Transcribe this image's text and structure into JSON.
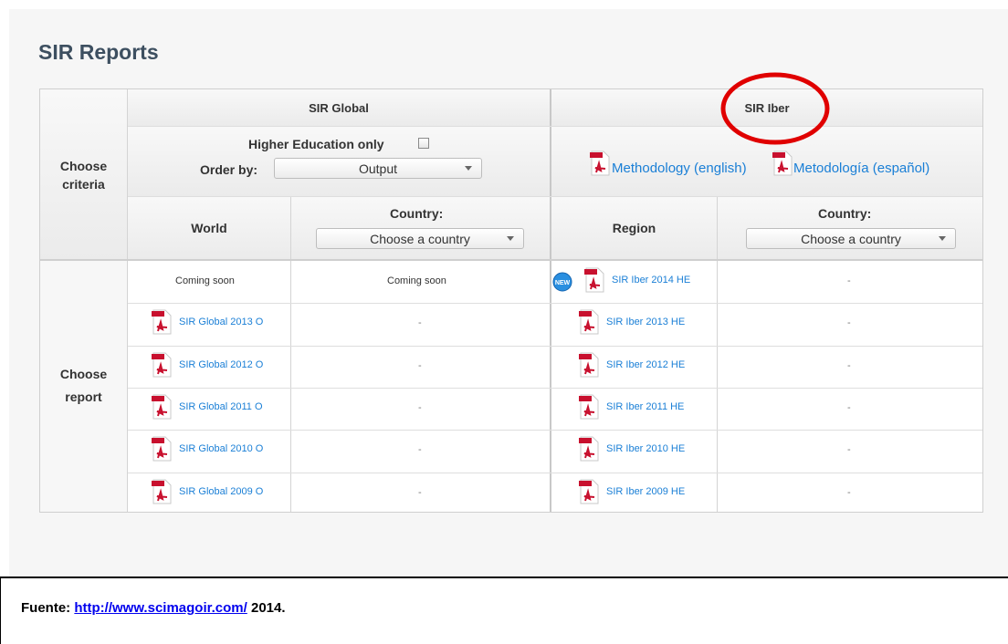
{
  "title": "SIR Reports",
  "headers": {
    "sir_global": "SIR Global",
    "sir_iber": "SIR Iber",
    "choose_criteria": "Choose criteria",
    "choose_report": "Choose report"
  },
  "criteria": {
    "higher_education_label": "Higher Education only",
    "order_by_label": "Order by:",
    "order_by_value": "Output",
    "methodology_en": "Methodology (english)",
    "methodology_es": "Metodología (español)"
  },
  "subheaders": {
    "world": "World",
    "country_label": "Country:",
    "country_placeholder": "Choose a country",
    "region": "Region"
  },
  "rows": [
    {
      "world": "Coming soon",
      "global_country": "Coming soon",
      "iber": "SIR Iber 2014 HE",
      "iber_country": "-",
      "is_new": true
    },
    {
      "world": "SIR Global 2013 O",
      "global_country": "-",
      "iber": "SIR Iber 2013 HE",
      "iber_country": "-"
    },
    {
      "world": "SIR Global 2012 O",
      "global_country": "-",
      "iber": "SIR Iber 2012 HE",
      "iber_country": "-"
    },
    {
      "world": "SIR Global 2011 O",
      "global_country": "-",
      "iber": "SIR Iber 2011 HE",
      "iber_country": "-"
    },
    {
      "world": "SIR Global 2010 O",
      "global_country": "-",
      "iber": "SIR Iber 2010 HE",
      "iber_country": "-"
    },
    {
      "world": "SIR Global 2009 O",
      "global_country": "-",
      "iber": "SIR Iber 2009 HE",
      "iber_country": "-"
    }
  ],
  "new_badge": "NEW",
  "pdf_badge": "PDF",
  "footer": {
    "label": "Fuente:",
    "url": "http://www.scimagoir.com/",
    "year": "2014."
  },
  "colors": {
    "link": "#1a7fd6",
    "title": "#3d4f60",
    "highlight_circle": "#e00000",
    "pdf_red": "#c8102e"
  },
  "icons": [
    "pdf-icon",
    "new-badge-icon",
    "checkbox",
    "dropdown-caret-icon"
  ]
}
